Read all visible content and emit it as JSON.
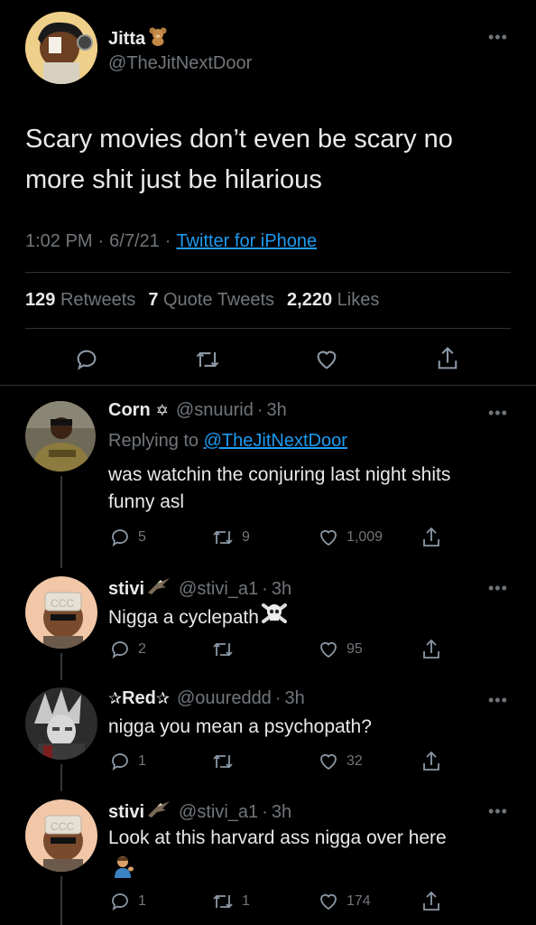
{
  "main_tweet": {
    "author_name": "Jitta",
    "author_handle": "@TheJitNextDoor",
    "text_line1": "Scary movies don’t even be scary no",
    "text_line2": "more shit just be hilarious",
    "time": "1:02 PM",
    "date": "6/7/21",
    "source": "Twitter for iPhone",
    "sep": "·",
    "retweets_count": "129",
    "retweets_label": "Retweets",
    "quotes_count": "7",
    "quotes_label": "Quote Tweets",
    "likes_count": "2,220",
    "likes_label": "Likes"
  },
  "replies": [
    {
      "name": "Corn",
      "handle": "@snuurid",
      "time": "3h",
      "replying_label": "Replying to",
      "replying_handle": "@TheJitNextDoor",
      "text_line1": "was watchin the conjuring last night shits",
      "text_line2": "funny asl",
      "reply_count": "5",
      "retweet_count": "9",
      "like_count": "1,009"
    },
    {
      "name": "stivi",
      "handle": "@stivi_a1",
      "time": "3h",
      "text_line1": "Nigga a cyclepath",
      "reply_count": "2",
      "retweet_count": "",
      "like_count": "95"
    },
    {
      "name": "Red",
      "handle": "@ouureddd",
      "time": "3h",
      "text_line1": "nigga you mean a psychopath?",
      "reply_count": "1",
      "retweet_count": "",
      "like_count": "32"
    },
    {
      "name": "stivi",
      "handle": "@stivi_a1",
      "time": "3h",
      "text_line1": "Look at this harvard ass nigga over here",
      "reply_count": "1",
      "retweet_count": "1",
      "like_count": "174"
    }
  ],
  "icons": {
    "reply": "speech-bubble-icon",
    "retweet": "retweet-icon",
    "like": "heart-icon",
    "share": "share-icon",
    "more": "more-dots-icon"
  },
  "colors": {
    "background": "#000000",
    "text": "#e7e9ea",
    "muted": "#71767b",
    "link": "#1d9bf0",
    "divider": "#2f3336"
  }
}
